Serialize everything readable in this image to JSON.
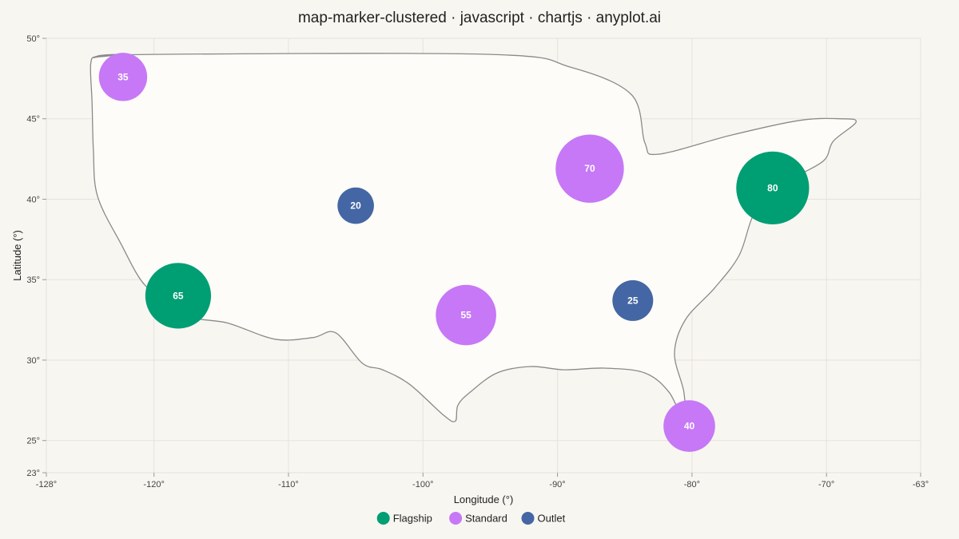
{
  "chart_data": {
    "type": "scatter",
    "title": "map-marker-clustered · javascript · chartjs · anyplot.ai",
    "xlabel": "Longitude (°)",
    "ylabel": "Latitude (°)",
    "xlim": [
      -128,
      -63
    ],
    "ylim": [
      23,
      50
    ],
    "x_ticks": [
      "-128°",
      "-120°",
      "-110°",
      "-100°",
      "-90°",
      "-80°",
      "-70°",
      "-63°"
    ],
    "y_ticks": [
      "23°",
      "25°",
      "30°",
      "35°",
      "40°",
      "45°",
      "50°"
    ],
    "x_tick_values": [
      -128,
      -120,
      -110,
      -100,
      -90,
      -80,
      -70,
      -63
    ],
    "y_tick_values": [
      23,
      25,
      30,
      35,
      40,
      45,
      50
    ],
    "grid": true,
    "legend_position": "bottom",
    "colors": {
      "Flagship": "#009e73",
      "Standard": "#c678f7",
      "Outlet": "#4466a4",
      "background": "#f8f6f1",
      "land": "#fdfcf8",
      "outline": "#8a8a8a"
    },
    "series": [
      {
        "name": "Flagship",
        "points": [
          {
            "lon": -118.2,
            "lat": 34.0,
            "count": 65
          },
          {
            "lon": -74.0,
            "lat": 40.7,
            "count": 80
          }
        ]
      },
      {
        "name": "Standard",
        "points": [
          {
            "lon": -122.3,
            "lat": 47.6,
            "count": 35
          },
          {
            "lon": -87.6,
            "lat": 41.9,
            "count": 70
          },
          {
            "lon": -96.8,
            "lat": 32.8,
            "count": 55
          },
          {
            "lon": -80.2,
            "lat": 25.9,
            "count": 40
          }
        ]
      },
      {
        "name": "Outlet",
        "points": [
          {
            "lon": -105.0,
            "lat": 39.6,
            "count": 20
          },
          {
            "lon": -84.4,
            "lat": 33.7,
            "count": 25
          }
        ]
      }
    ],
    "outline": [
      [
        -124.5,
        48.8
      ],
      [
        -120,
        49
      ],
      [
        -95,
        49
      ],
      [
        -89,
        48.2
      ],
      [
        -84.5,
        46.5
      ],
      [
        -83.5,
        43.5
      ],
      [
        -82.5,
        42.8
      ],
      [
        -77,
        44
      ],
      [
        -72,
        44.9
      ],
      [
        -69,
        45
      ],
      [
        -67.8,
        44.8
      ],
      [
        -69.5,
        43.6
      ],
      [
        -70.2,
        42.4
      ],
      [
        -72.5,
        41.3
      ],
      [
        -74.3,
        40.3
      ],
      [
        -75.5,
        38.9
      ],
      [
        -76.5,
        36.5
      ],
      [
        -78.3,
        34.5
      ],
      [
        -80.5,
        32.5
      ],
      [
        -81.3,
        30.4
      ],
      [
        -80.6,
        28.0
      ],
      [
        -80.6,
        26.2
      ],
      [
        -81.7,
        28.0
      ],
      [
        -83.5,
        29.2
      ],
      [
        -86.5,
        29.5
      ],
      [
        -89.5,
        29.4
      ],
      [
        -92.0,
        29.6
      ],
      [
        -94.5,
        29.2
      ],
      [
        -96.5,
        28.0
      ],
      [
        -97.4,
        27.2
      ],
      [
        -97.6,
        26.2
      ],
      [
        -98.5,
        26.6
      ],
      [
        -101,
        28.5
      ],
      [
        -103,
        29.4
      ],
      [
        -104.5,
        29.8
      ],
      [
        -106.5,
        31.7
      ],
      [
        -108.2,
        31.4
      ],
      [
        -111,
        31.3
      ],
      [
        -114.5,
        32.3
      ],
      [
        -117.2,
        32.7
      ],
      [
        -118.5,
        34.0
      ],
      [
        -120.6,
        34.6
      ],
      [
        -122.5,
        37.3
      ],
      [
        -124.2,
        40.2
      ],
      [
        -124.5,
        43.0
      ],
      [
        -124.6,
        46.0
      ],
      [
        -124.7,
        48.4
      ],
      [
        -124.2,
        48.9
      ],
      [
        -122.3,
        49.0
      ]
    ]
  }
}
